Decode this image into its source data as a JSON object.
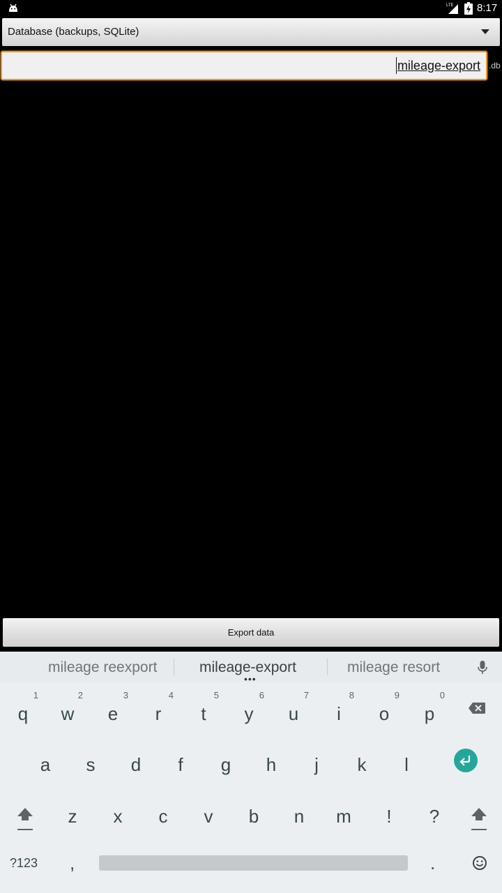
{
  "status_bar": {
    "time": "8:17",
    "network_label": "LTE",
    "icons": [
      "android-notification-icon",
      "lte-signal-icon",
      "battery-charging-icon"
    ]
  },
  "spinner": {
    "selected": "Database (backups, SQLite)"
  },
  "filename_input": {
    "value": "mileage-export",
    "suffix": ".db"
  },
  "export_button": {
    "label": "Export data"
  },
  "keyboard": {
    "suggestions": [
      "mileage reexport",
      "mileage-export",
      "mileage resort"
    ],
    "suggestion_dots": "•••",
    "row1": [
      {
        "key": "q",
        "hint": "1"
      },
      {
        "key": "w",
        "hint": "2"
      },
      {
        "key": "e",
        "hint": "3"
      },
      {
        "key": "r",
        "hint": "4"
      },
      {
        "key": "t",
        "hint": "5"
      },
      {
        "key": "y",
        "hint": "6"
      },
      {
        "key": "u",
        "hint": "7"
      },
      {
        "key": "i",
        "hint": "8"
      },
      {
        "key": "o",
        "hint": "9"
      },
      {
        "key": "p",
        "hint": "0"
      }
    ],
    "row2": [
      "a",
      "s",
      "d",
      "f",
      "g",
      "h",
      "j",
      "k",
      "l"
    ],
    "row3": [
      "z",
      "x",
      "c",
      "v",
      "b",
      "n",
      "m",
      "!",
      "?"
    ],
    "symbols_label": "?123",
    "comma": ",",
    "period": ".",
    "accent_color": "#26a69a"
  },
  "colors": {
    "input_focus_border": "#f0962c",
    "background": "#000000"
  }
}
